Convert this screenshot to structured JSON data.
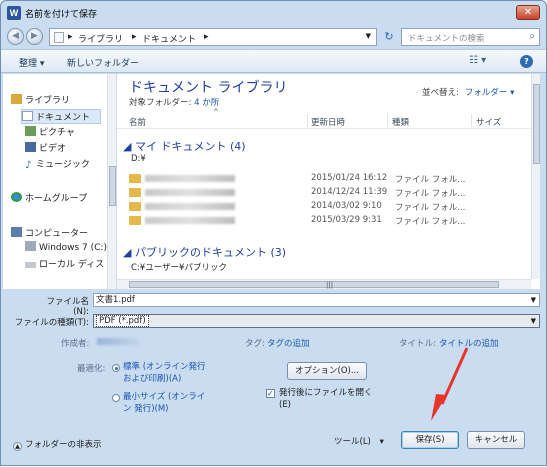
{
  "window": {
    "icon": "W",
    "title": "名前を付けて保存",
    "close": "✕"
  },
  "address": {
    "crumbs": [
      "ライブラリ",
      "ドキュメント"
    ],
    "separator": "▸"
  },
  "search": {
    "placeholder": "ドキュメントの検索"
  },
  "toolbar": {
    "organize": "整理 ▾",
    "new_folder": "新しいフォルダー"
  },
  "nav": {
    "items": [
      "ライブラリ",
      "ドキュメント",
      "ピクチャ",
      "ビデオ",
      "ミュージック",
      "ホームグループ",
      "コンピューター",
      "Windows 7 (C:)",
      "ローカル ディス"
    ]
  },
  "library": {
    "title": "ドキュメント ライブラリ",
    "subtitle_prefix": "対象フォルダー: ",
    "subtitle_link": "4 か所",
    "arrange_label": "並べ替え:",
    "arrange_value": "フォルダー ▾"
  },
  "columns": {
    "name": "名前",
    "date": "更新日時",
    "type": "種類",
    "size": "サイズ"
  },
  "groups": [
    {
      "title": "マイ ドキュメント (4)",
      "path": "D:¥"
    },
    {
      "title": "パブリックのドキュメント (3)",
      "path": "C:¥ユーザー¥パブリック"
    }
  ],
  "rows": [
    {
      "date": "2015/01/24 16:12",
      "type": "ファイル フォル..."
    },
    {
      "date": "2014/12/24 11:39",
      "type": "ファイル フォル..."
    },
    {
      "date": "2014/03/02 9:10",
      "type": "ファイル フォル..."
    },
    {
      "date": "2015/03/29 9:31",
      "type": "ファイル フォル..."
    }
  ],
  "form": {
    "filename_label": "ファイル名(N):",
    "filename_value": "文書1.pdf",
    "filetype_label": "ファイルの種類(T):",
    "filetype_value": "PDF (*.pdf)",
    "author_label": "作成者:",
    "tags_label": "タグ:",
    "tags_link": "タグの追加",
    "title_label": "タイトル:",
    "title_link": "タイトルの追加"
  },
  "optimize": {
    "label": "最適化:",
    "standard": "標準 (オンライン発行 および印刷)(A)",
    "minimum": "最小サイズ (オンライン 発行)(M)",
    "options_button": "オプション(O)...",
    "open_after": "発行後にファイルを開く (E)"
  },
  "footer": {
    "hide_folders": "フォルダーの非表示",
    "tools": "ツール(L)",
    "tools_arrow": "▾",
    "save": "保存(S)",
    "cancel": "キャンセル"
  },
  "colors": {
    "accent": "#1f3f9e",
    "link": "#1a55b5",
    "annotation_arrow": "#e8352b"
  }
}
